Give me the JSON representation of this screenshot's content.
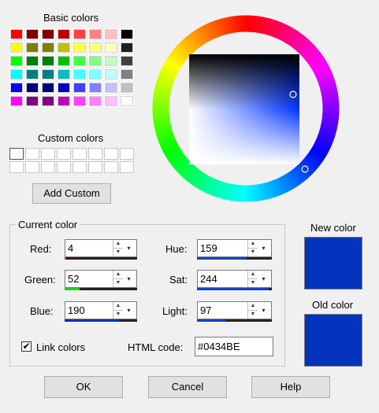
{
  "basic_colors_label": "Basic colors",
  "custom_colors_label": "Custom colors",
  "add_custom_label": "Add Custom",
  "current_color_label": "Current color",
  "new_color_label": "New color",
  "old_color_label": "Old color",
  "basic_colors": [
    "#FF0000",
    "#800000",
    "#800000",
    "#C00000",
    "#FF4040",
    "#FF8080",
    "#FFC0C0",
    "#000000",
    "#FFFF00",
    "#808000",
    "#808000",
    "#C0C000",
    "#FFFF40",
    "#FFFF80",
    "#FFFFC0",
    "#202020",
    "#00FF00",
    "#008000",
    "#008000",
    "#00C000",
    "#40FF40",
    "#80FF80",
    "#C0FFC0",
    "#404040",
    "#00FFFF",
    "#008080",
    "#008080",
    "#00C0C0",
    "#40FFFF",
    "#80FFFF",
    "#C0FFFF",
    "#808080",
    "#0000FF",
    "#000080",
    "#000080",
    "#0000C0",
    "#4040FF",
    "#8080FF",
    "#C0C0FF",
    "#C0C0C0",
    "#FF00FF",
    "#800080",
    "#800080",
    "#C000C0",
    "#FF40FF",
    "#FF80FF",
    "#FFC0FF",
    "#FFFFFF"
  ],
  "fields": {
    "red": {
      "label": "Red:",
      "value": "4"
    },
    "green": {
      "label": "Green:",
      "value": "52"
    },
    "blue": {
      "label": "Blue:",
      "value": "190"
    },
    "hue": {
      "label": "Hue:",
      "value": "159"
    },
    "sat": {
      "label": "Sat:",
      "value": "244"
    },
    "light": {
      "label": "Light:",
      "value": "97"
    }
  },
  "levels": {
    "red": 0.016,
    "green": 0.204,
    "blue": 0.745,
    "hue": 0.66,
    "sat": 0.96,
    "light": 0.38
  },
  "link_colors": {
    "label": "Link colors",
    "checked": true,
    "mark": "✔"
  },
  "html_code": {
    "label": "HTML code:",
    "value": "#0434BE"
  },
  "new_color": "#0434BE",
  "old_color": "#0434BE",
  "buttons": {
    "ok": "OK",
    "cancel": "Cancel",
    "help": "Help"
  },
  "icons": {
    "spin_up": "▲",
    "spin_down": "▼",
    "dropdown": "▾"
  }
}
